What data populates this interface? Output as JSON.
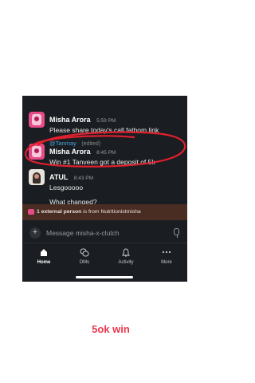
{
  "messages": [
    {
      "author": "Misha Arora",
      "time": "5:59 PM",
      "text": "Please share today's call fathom link",
      "mention": "@Tanmay",
      "edited": "(edited)"
    },
    {
      "author": "Misha Arora",
      "time": "8:45 PM",
      "text": "Win #1 Tanveen got a deposit of 5k"
    },
    {
      "author": "ATUL",
      "time": "8:43 PM",
      "lines": [
        "Lesgooooo",
        "What changed?"
      ]
    }
  ],
  "external_banner": {
    "count_text": "1 external person",
    "rest_text": " is from Nutritionistmisha"
  },
  "composer": {
    "placeholder": "Message misha-x-clutch"
  },
  "nav": [
    {
      "label": "Home",
      "icon": "home-icon",
      "active": true
    },
    {
      "label": "DMs",
      "icon": "dms-icon"
    },
    {
      "label": "Activity",
      "icon": "bell-icon"
    },
    {
      "label": "More",
      "icon": "more-icon"
    }
  ],
  "annotation_color": "#e0202e",
  "caption": "5ok win"
}
